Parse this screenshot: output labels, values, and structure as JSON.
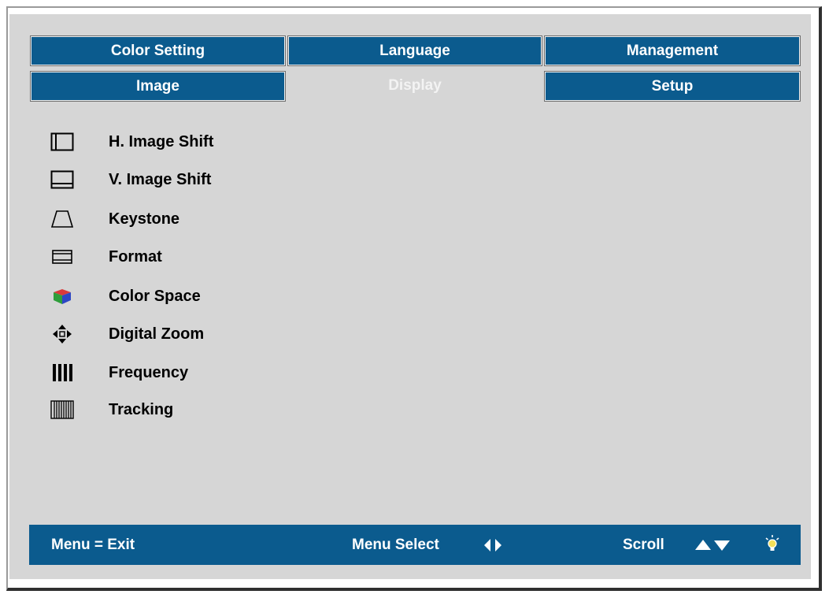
{
  "tabs": {
    "row1": [
      "Color Setting",
      "Language",
      "Management"
    ],
    "row2": [
      "Image",
      "Display",
      "Setup"
    ],
    "active": "Display"
  },
  "menu": {
    "items": [
      {
        "label": "H. Image Shift",
        "icon": "h-image-shift-icon"
      },
      {
        "label": "V. Image Shift",
        "icon": "v-image-shift-icon"
      },
      {
        "label": "Keystone",
        "icon": "keystone-icon"
      },
      {
        "label": "Format",
        "icon": "format-icon"
      },
      {
        "label": "Color Space",
        "icon": "color-space-icon"
      },
      {
        "label": "Digital Zoom",
        "icon": "digital-zoom-icon"
      },
      {
        "label": "Frequency",
        "icon": "frequency-icon"
      },
      {
        "label": "Tracking",
        "icon": "tracking-icon"
      }
    ]
  },
  "status_bar": {
    "exit": "Menu = Exit",
    "select": "Menu Select",
    "scroll": "Scroll",
    "select_icon": "left-right-arrows-icon",
    "scroll_icon": "up-down-arrows-icon",
    "bulb_icon": "bulb-icon"
  },
  "colors": {
    "tab_blue": "#0b5b8e",
    "panel_gray": "#d6d6d6",
    "active_tab_text": "#f3f3f3"
  }
}
